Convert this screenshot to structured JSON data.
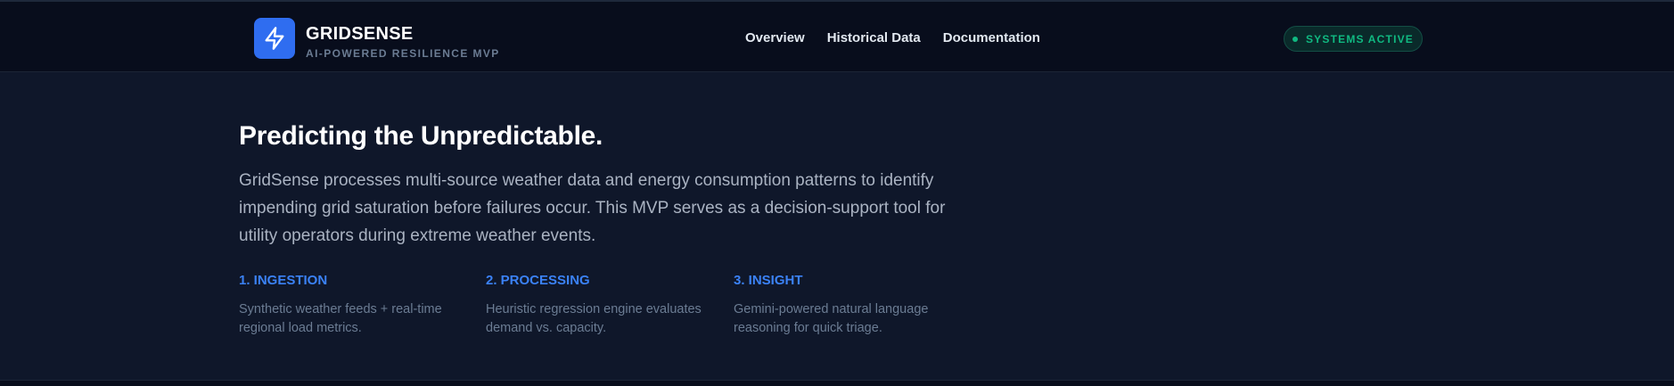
{
  "header": {
    "brand_title": "GRIDSENSE",
    "brand_subtitle": "AI-POWERED RESILIENCE MVP",
    "logo_icon": "lightning-bolt-icon",
    "nav": [
      {
        "label": "Overview"
      },
      {
        "label": "Historical Data"
      },
      {
        "label": "Documentation"
      }
    ],
    "status": {
      "label": "SYSTEMS ACTIVE",
      "color": "#10b981"
    }
  },
  "hero": {
    "title": "Predicting the Unpredictable.",
    "description": "GridSense processes multi-source weather data and energy consumption patterns to identify impending grid saturation before failures occur. This MVP serves as a decision-support tool for utility operators during extreme weather events."
  },
  "steps": [
    {
      "title": "1. INGESTION",
      "description": "Synthetic weather feeds + real-time regional load metrics."
    },
    {
      "title": "2. PROCESSING",
      "description": "Heuristic regression engine evaluates demand vs. capacity."
    },
    {
      "title": "3. INSIGHT",
      "description": "Gemini-powered natural language reasoning for quick triage."
    }
  ],
  "colors": {
    "accent": "#2f6df0",
    "step_title": "#3b82f6",
    "background": "#0f172a"
  }
}
